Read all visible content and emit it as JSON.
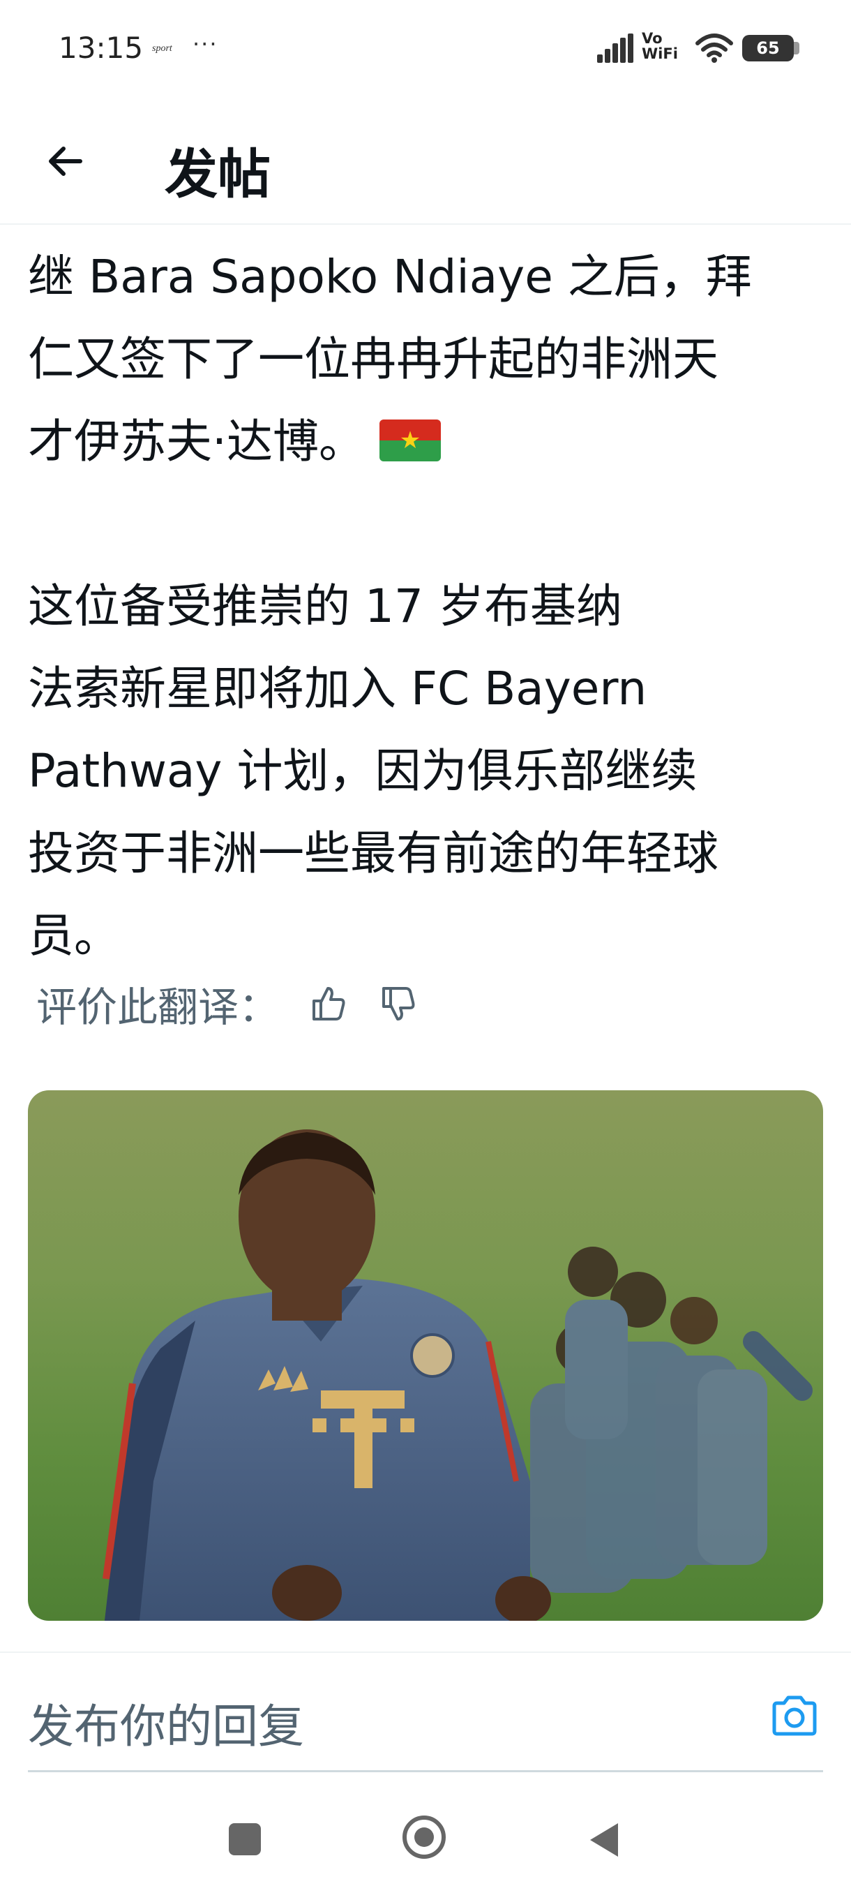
{
  "status_bar": {
    "time": "13:15",
    "sport_label": "sport",
    "more_dots": "···",
    "vowifi_top": "Vo",
    "vowifi_bottom": "WiFi",
    "battery": "65"
  },
  "header": {
    "back_icon": "arrow-left-icon",
    "title": "发帖"
  },
  "post": {
    "paragraph1": [
      "继 Bara Sapoko Ndiaye 之后，拜",
      "仁又签下了一位冉冉升起的非洲天",
      "才伊苏夫·达博。"
    ],
    "flag_icon": "burkina-faso-flag-icon",
    "flag_star": "★",
    "paragraph2": [
      "这位备受推崇的 17 岁布基纳",
      "法索新星即将加入 FC Bayern",
      "Pathway 计划，因为俱乐部继续",
      "投资于非洲一些最有前途的年轻球",
      "员。"
    ],
    "rate_translation_label": "评价此翻译："
  },
  "reply": {
    "placeholder": "发布你的回复",
    "camera_icon": "camera-icon"
  },
  "colors": {
    "text": "#0f1419",
    "secondary_text": "#536471",
    "accent": "#1d9bf0",
    "divider": "#eff3f4"
  }
}
